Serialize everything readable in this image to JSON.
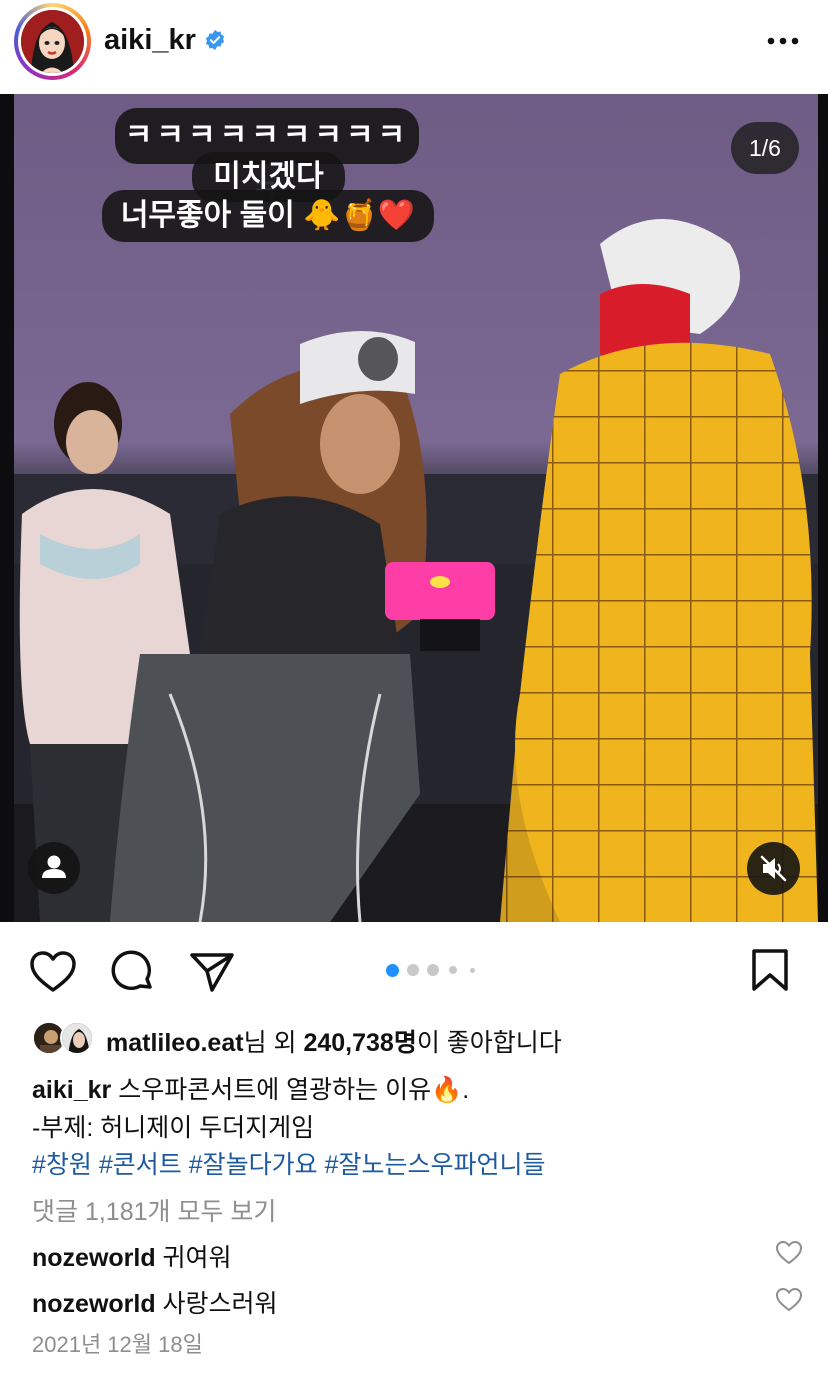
{
  "post": {
    "username": "aiki_kr",
    "verified": true,
    "more_icon": "more-horizontal-icon"
  },
  "media": {
    "overlay_lines": [
      "ㅋㅋㅋㅋㅋㅋㅋㅋㅋㅋ",
      "미치겠다",
      "너무좋아 둘이 🐥🍯❤️"
    ],
    "counter": "1/6",
    "tag_icon": "person-icon",
    "mute_icon": "speaker-muted-icon"
  },
  "actions": {
    "like_icon": "heart-icon",
    "comment_icon": "comment-icon",
    "share_icon": "send-icon",
    "save_icon": "bookmark-icon",
    "carousel_active_index": 0,
    "carousel_dot_count": 6,
    "accent": "#1e90ff"
  },
  "likes": {
    "liker": "matlileo.eat",
    "middle": "님 외 ",
    "count": "240,738명",
    "suffix": "이 좋아합니다"
  },
  "caption": {
    "username": "aiki_kr",
    "text": " 스우파콘서트에 열광하는 이유🔥.",
    "line2": "-부제: 허니제이 두더지게임",
    "hashtags": [
      "#창원",
      "#콘서트",
      "#잘놀다가요",
      "#잘노는스우파언니들"
    ]
  },
  "comments": {
    "view_all": "댓글 1,181개 모두 보기",
    "items": [
      {
        "user": "nozeworld",
        "text": " 귀여워"
      },
      {
        "user": "nozeworld",
        "text": " 사랑스러워"
      }
    ]
  },
  "date": "2021년 12월 18일"
}
